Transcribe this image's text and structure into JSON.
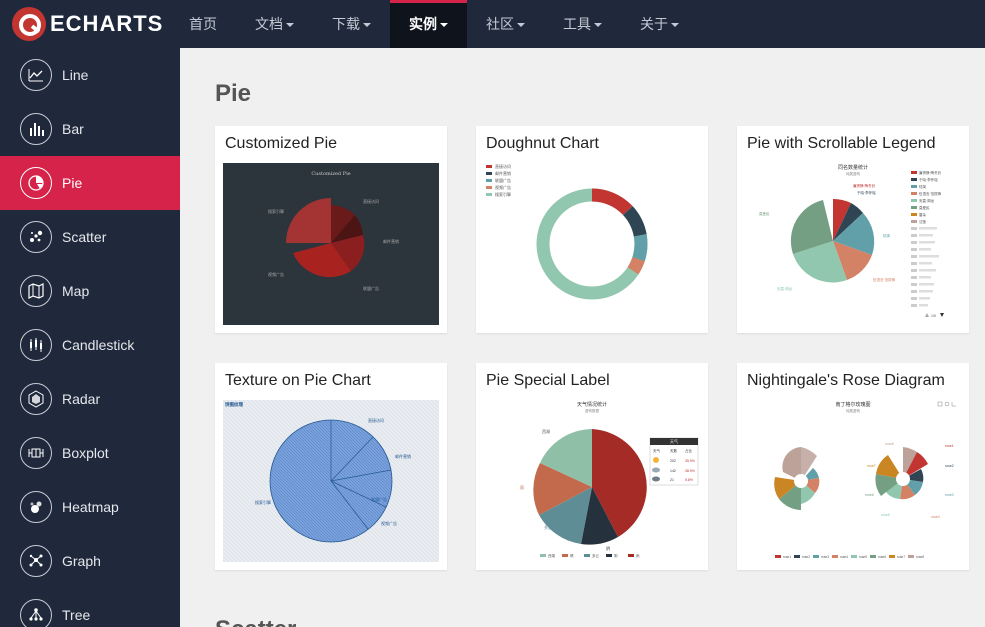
{
  "header": {
    "logo_text": "ECHARTS",
    "nav": [
      {
        "label": "首页"
      },
      {
        "label": "文档"
      },
      {
        "label": "下载"
      },
      {
        "label": "实例"
      },
      {
        "label": "社区"
      },
      {
        "label": "工具"
      },
      {
        "label": "关于"
      }
    ]
  },
  "sidebar": {
    "items": [
      {
        "label": "Line",
        "icon": "line-chart-icon"
      },
      {
        "label": "Bar",
        "icon": "bar-chart-icon"
      },
      {
        "label": "Pie",
        "icon": "pie-chart-icon"
      },
      {
        "label": "Scatter",
        "icon": "scatter-icon"
      },
      {
        "label": "Map",
        "icon": "map-icon"
      },
      {
        "label": "Candlestick",
        "icon": "candlestick-icon"
      },
      {
        "label": "Radar",
        "icon": "radar-icon"
      },
      {
        "label": "Boxplot",
        "icon": "boxplot-icon"
      },
      {
        "label": "Heatmap",
        "icon": "heatmap-icon"
      },
      {
        "label": "Graph",
        "icon": "graph-icon"
      },
      {
        "label": "Tree",
        "icon": "tree-icon"
      }
    ],
    "active_index": 2
  },
  "main": {
    "section_title": "Pie",
    "next_section_title": "Scatter",
    "cards": [
      {
        "title": "Customized Pie"
      },
      {
        "title": "Doughnut Chart"
      },
      {
        "title": "Pie with Scrollable Legend"
      },
      {
        "title": "Texture on Pie Chart"
      },
      {
        "title": "Pie Special Label"
      },
      {
        "title": "Nightingale's Rose Diagram"
      }
    ]
  },
  "thumbs": {
    "customized": {
      "title": "Customized Pie",
      "labels": [
        "搜索引擎",
        "直接访问",
        "邮件营销",
        "联盟广告",
        "视频广告"
      ]
    },
    "doughnut": {
      "legend": [
        "直接访问",
        "邮件营销",
        "联盟广告",
        "视频广告",
        "搜索引擎"
      ]
    },
    "scrollable": {
      "title": "同名数量统计",
      "subtitle": "纯属虚构",
      "labels": [
        "廉贤静·陶冬铃",
        "于晓·李怀瑶",
        "陆寓",
        "伍语言·范振锋",
        "安嘉·闻龙",
        "莫爱民",
        "雷朵",
        "沈莹"
      ],
      "page": "1/5"
    },
    "texture": {
      "title": "饼图纹理",
      "labels": [
        "直接访问",
        "邮件营销",
        "联盟广告",
        "视频广告",
        "搜索引擎"
      ]
    },
    "special": {
      "title": "天气情况统计",
      "subtitle": "虚构数据",
      "table_title": "天气",
      "table_head": [
        "天气",
        "天数",
        "占比"
      ],
      "table_rows": [
        [
          "202",
          "35.9%"
        ],
        [
          "142",
          "38.9%"
        ],
        [
          "21",
          "5.8%"
        ]
      ],
      "labels": [
        "西湖",
        "晴",
        "多云",
        "阴",
        "雨",
        "雪"
      ]
    },
    "rose": {
      "title": "南丁格尔玫瑰图",
      "subtitle": "纯属虚构",
      "labels": [
        "rose1",
        "rose2",
        "rose3",
        "rose4",
        "rose5",
        "rose6",
        "rose7",
        "rose8"
      ]
    }
  }
}
